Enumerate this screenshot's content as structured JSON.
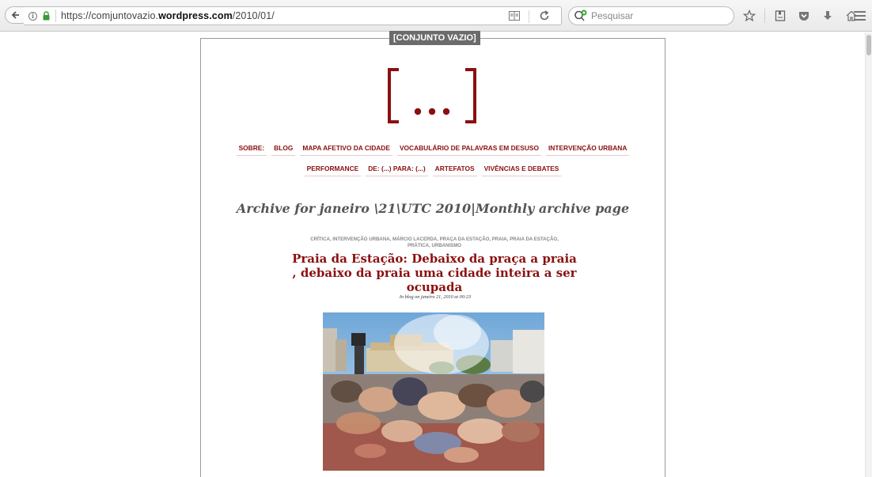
{
  "browser": {
    "url_prefix": "https://comjuntovazio.",
    "url_domain": "wordpress.com",
    "url_suffix": "/2010/01/",
    "search_placeholder": "Pesquisar"
  },
  "site": {
    "tag": "[CONJUNTO VAZIO]",
    "logo_text": "[...]",
    "accent_color": "#8b1010"
  },
  "nav": {
    "row1": [
      {
        "label": "SOBRE:"
      },
      {
        "label": "BLOG"
      },
      {
        "label": "MAPA AFETIVO DA CIDADE"
      },
      {
        "label": "VOCABULÁRIO DE PALAVRAS EM DESUSO"
      },
      {
        "label": "INTERVENÇÃO URBANA"
      }
    ],
    "row2": [
      {
        "label": "PERFORMANCE"
      },
      {
        "label": "DE: (...) PARA: (...)"
      },
      {
        "label": "ARTEFATOS"
      },
      {
        "label": "VIVÊNCIAS E DEBATES"
      }
    ]
  },
  "archive": {
    "title": "Archive for janeiro \\21\\UTC 2010|Monthly archive page"
  },
  "post": {
    "categories": "CRÍTICA, INTERVENÇÃO URBANA, MÁRCIO LACERDA, PRAÇA DA ESTAÇÃO, PRAIA, PRAIA DA ESTAÇÃO, PRÁTICA, URBANISMO",
    "title": "Praia da Estação: Debaixo da praça a praia , debaixo da praia uma cidade inteira a ser ocupada",
    "meta": "In blog on janeiro 21, 2010 at 00:23"
  }
}
